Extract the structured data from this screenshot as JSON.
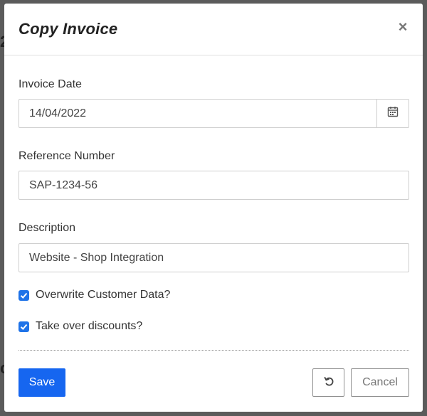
{
  "dialog": {
    "title": "Copy Invoice",
    "close_icon": "close-icon"
  },
  "form": {
    "invoice_date": {
      "label": "Invoice Date",
      "value": "14/04/2022",
      "icon": "calendar-icon"
    },
    "reference_number": {
      "label": "Reference Number",
      "value": "SAP-1234-56"
    },
    "description": {
      "label": "Description",
      "value": "Website - Shop Integration"
    },
    "overwrite_customer_data": {
      "label": "Overwrite Customer Data?",
      "checked": true
    },
    "take_over_discounts": {
      "label": "Take over discounts?",
      "checked": true
    }
  },
  "footer": {
    "save_label": "Save",
    "reset_icon": "reset-icon",
    "cancel_label": "Cancel"
  },
  "colors": {
    "primary": "#1666f0",
    "checkbox": "#1f73e8"
  }
}
